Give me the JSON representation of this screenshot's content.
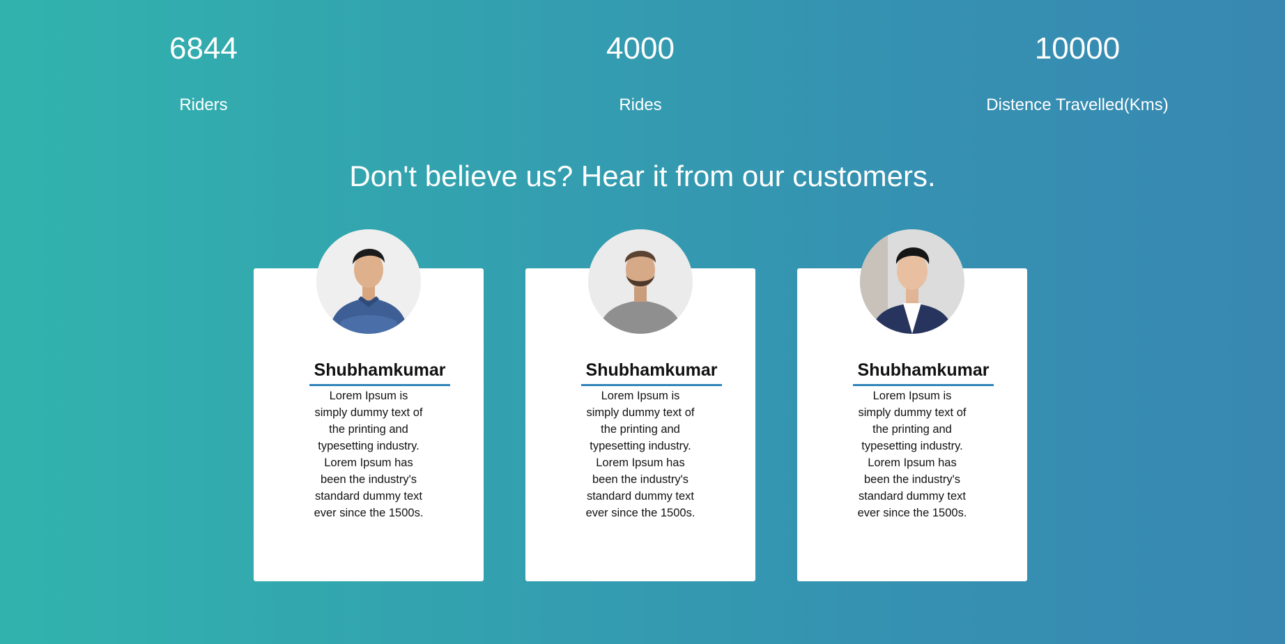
{
  "stats": [
    {
      "value": "6844",
      "label": "Riders"
    },
    {
      "value": "4000",
      "label": "Rides"
    },
    {
      "value": "10000",
      "label": "Distence Travelled(Kms)"
    }
  ],
  "section": {
    "title": "Don't believe us? Hear it from our customers."
  },
  "testimonials": [
    {
      "name": "Shubhamkumar",
      "text": "Lorem Ipsum is simply dummy text of the printing and typesetting industry. Lorem Ipsum has been the industry's standard dummy text ever since the 1500s.",
      "avatar_icon": "avatar-man-denim-shirt"
    },
    {
      "name": "Shubhamkumar",
      "text": "Lorem Ipsum is simply dummy text of the printing and typesetting industry. Lorem Ipsum has been the industry's standard dummy text ever since the 1500s.",
      "avatar_icon": "avatar-man-grey-tshirt"
    },
    {
      "name": "Shubhamkumar",
      "text": "Lorem Ipsum is simply dummy text of the printing and typesetting industry. Lorem Ipsum has been the industry's standard dummy text ever since the 1500s.",
      "avatar_icon": "avatar-man-suit"
    }
  ],
  "colors": {
    "gradient_start": "#31b3ad",
    "gradient_end": "#3888b2",
    "accent_underline": "#2f84b8",
    "card_background": "#ffffff"
  }
}
